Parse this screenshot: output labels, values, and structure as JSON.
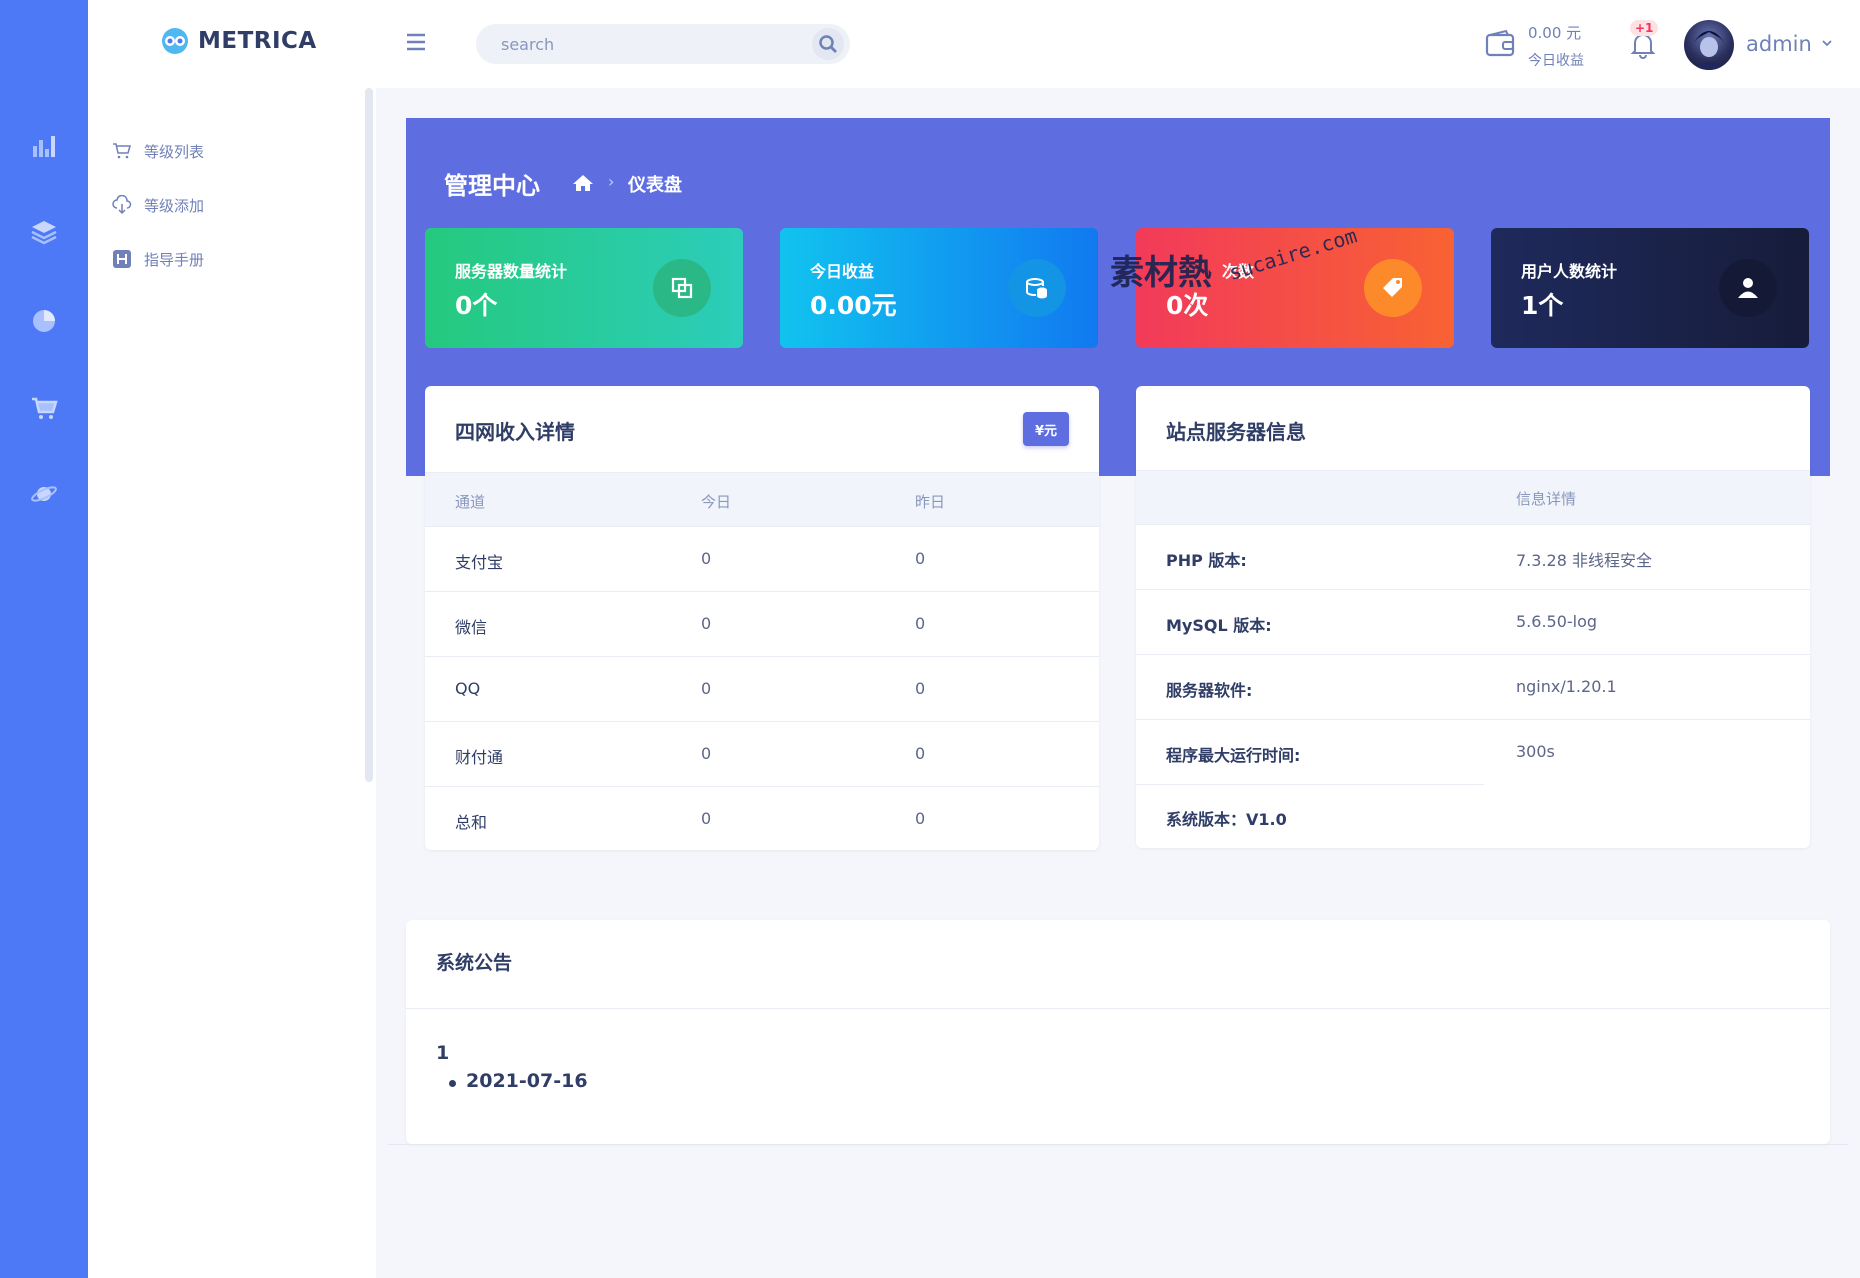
{
  "brand": {
    "name": "METRICA"
  },
  "rail": {
    "items": [
      "chart-icon",
      "layers-icon",
      "pie-icon",
      "cart-icon",
      "planet-icon"
    ]
  },
  "sidebar": {
    "items": [
      {
        "label": "等级列表",
        "icon": "cart-icon"
      },
      {
        "label": "等级添加",
        "icon": "cloud-download-icon"
      },
      {
        "label": "指导手册",
        "icon": "h-square-icon"
      }
    ]
  },
  "topbar": {
    "search_placeholder": "search",
    "earnings_value": "0.00 元",
    "earnings_label": "今日收益",
    "notification_badge": "+1",
    "user_name": "admin"
  },
  "header": {
    "title": "管理中心",
    "breadcrumb_current": "仪表盘",
    "breadcrumb_sep": "›"
  },
  "stats": [
    {
      "label": "服务器数量统计",
      "value": "0个",
      "icon": "copy-icon"
    },
    {
      "label": "今日收益",
      "value": "0.00元",
      "icon": "coins-icon"
    },
    {
      "label": "次数",
      "value": "0次",
      "icon": "tag-icon"
    },
    {
      "label": "用户人数统计",
      "value": "1个",
      "icon": "user-icon"
    }
  ],
  "watermark": {
    "text": "素材熱",
    "sub": "sucaire.com"
  },
  "income": {
    "title": "四网收入详情",
    "unit_button": "¥元",
    "columns": [
      "通道",
      "今日",
      "昨日"
    ],
    "rows": [
      {
        "channel": "支付宝",
        "today": "0",
        "yesterday": "0"
      },
      {
        "channel": "微信",
        "today": "0",
        "yesterday": "0"
      },
      {
        "channel": "QQ",
        "today": "0",
        "yesterday": "0"
      },
      {
        "channel": "财付通",
        "today": "0",
        "yesterday": "0"
      },
      {
        "channel": "总和",
        "today": "0",
        "yesterday": "0"
      }
    ]
  },
  "server": {
    "title": "站点服务器信息",
    "column": "信息详情",
    "rows": [
      {
        "key": "PHP 版本:",
        "value": "7.3.28 非线程安全"
      },
      {
        "key": "MySQL 版本:",
        "value": "5.6.50-log"
      },
      {
        "key": "服务器软件:",
        "value": "nginx/1.20.1"
      },
      {
        "key": "程序最大运行时间:",
        "value": "300s"
      },
      {
        "key": "系统版本：V1.0",
        "value": ""
      }
    ]
  },
  "notice": {
    "title": "系统公告",
    "number": "1",
    "date": "2021-07-16"
  },
  "colors": {
    "rail": "#4d79f6",
    "band": "#5e6ee0",
    "text": "#303e67"
  }
}
